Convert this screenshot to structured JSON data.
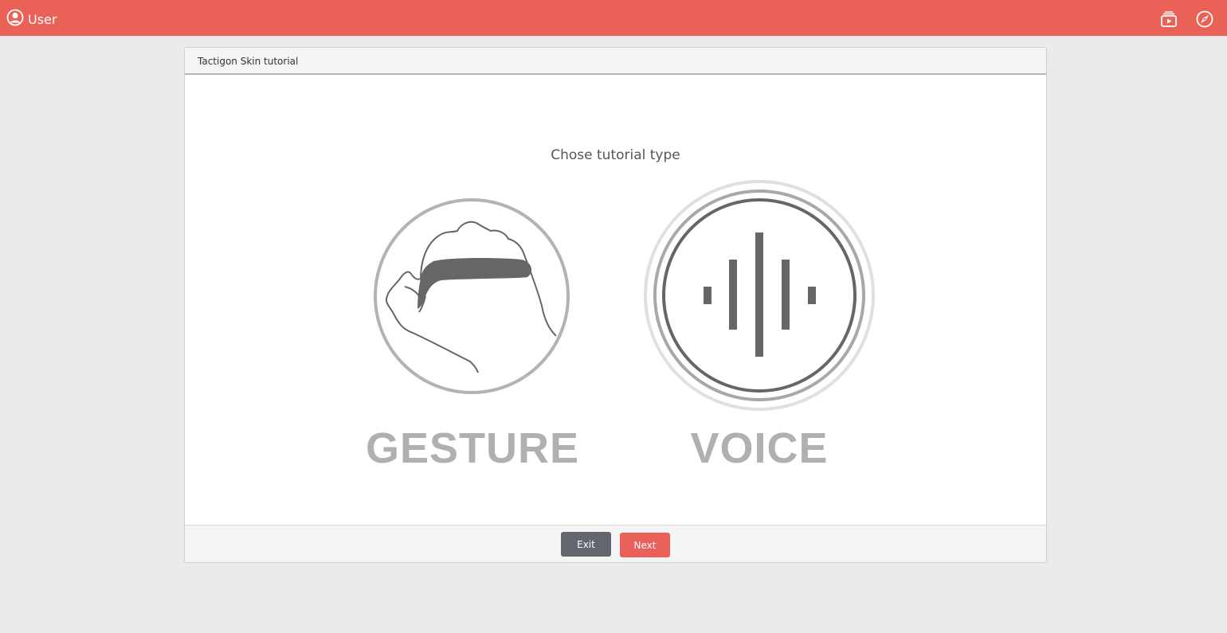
{
  "topbar": {
    "user_label": "User",
    "icons": [
      "user-circle-icon",
      "video-tutorial-icon",
      "compass-icon"
    ],
    "color": "#ea6157"
  },
  "dialog": {
    "title": "Tactigon Skin tutorial",
    "subtitle": "Chose tutorial type",
    "choices": [
      {
        "label": "GESTURE",
        "icon": "gesture-hand-icon"
      },
      {
        "label": "VOICE",
        "icon": "voice-waveform-icon"
      }
    ],
    "buttons": {
      "exit": "Exit",
      "next": "Next"
    },
    "colors": {
      "exit": "#62666d",
      "next": "#e9605a"
    }
  }
}
